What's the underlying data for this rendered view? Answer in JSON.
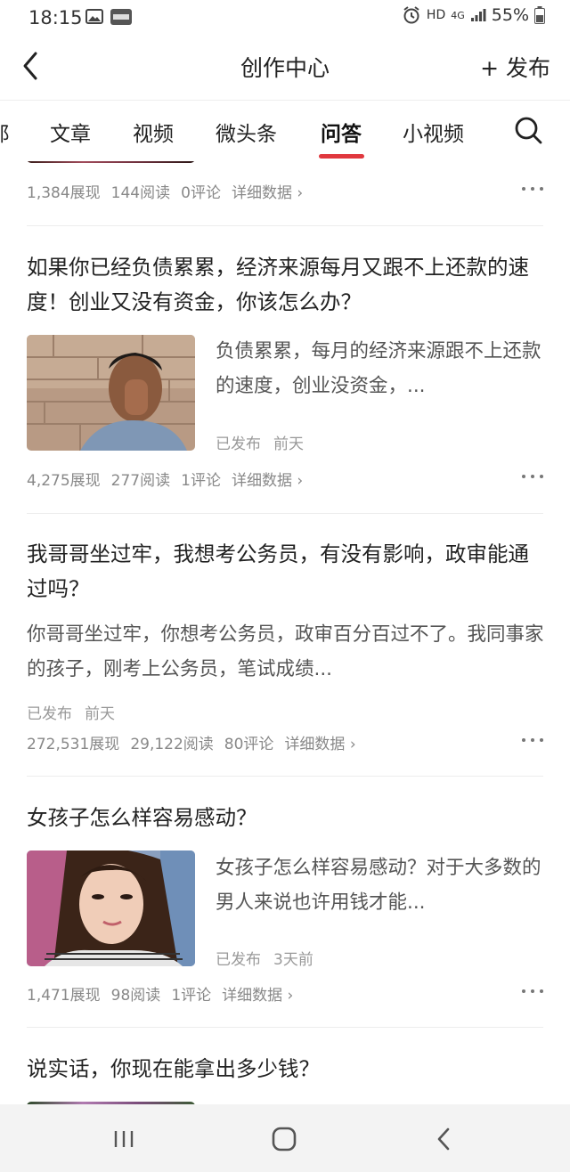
{
  "status": {
    "time": "18:15",
    "net": "HD",
    "net_gen": "4G",
    "battery": "55%"
  },
  "header": {
    "title": "创作中心",
    "publish_label": "+ 发布"
  },
  "tabs": [
    {
      "label": "郎"
    },
    {
      "label": "文章"
    },
    {
      "label": "视频"
    },
    {
      "label": "微头条"
    },
    {
      "label": "问答",
      "active": true
    },
    {
      "label": "小视频"
    }
  ],
  "items": [
    {
      "stats": {
        "views": "1,384展现",
        "reads": "144阅读",
        "comments": "0评论",
        "detail": "详细数据 ›"
      }
    },
    {
      "title": "如果你已经负债累累，经济来源每月又跟不上还款的速度！创业又没有资金，你该怎么办？",
      "excerpt": "负债累累，每月的经济来源跟不上还款的速度，创业没资金，...",
      "status": "已发布",
      "time": "前天",
      "stats": {
        "views": "4,275展现",
        "reads": "277阅读",
        "comments": "1评论",
        "detail": "详细数据 ›"
      }
    },
    {
      "title": "我哥哥坐过牢，我想考公务员，有没有影响，政审能通过吗？",
      "excerpt": "你哥哥坐过牢，你想考公务员，政审百分百过不了。我同事家的孩子，刚考上公务员，笔试成绩...",
      "status": "已发布",
      "time": "前天",
      "stats": {
        "views": "272,531展现",
        "reads": "29,122阅读",
        "comments": "80评论",
        "detail": "详细数据 ›"
      }
    },
    {
      "title": "女孩子怎么样容易感动？",
      "excerpt": "女孩子怎么样容易感动？对于大多数的男人来说也许用钱才能...",
      "status": "已发布",
      "time": "3天前",
      "stats": {
        "views": "1,471展现",
        "reads": "98阅读",
        "comments": "1评论",
        "detail": "详细数据 ›"
      }
    },
    {
      "title": "说实话，你现在能拿出多少钱？"
    }
  ]
}
